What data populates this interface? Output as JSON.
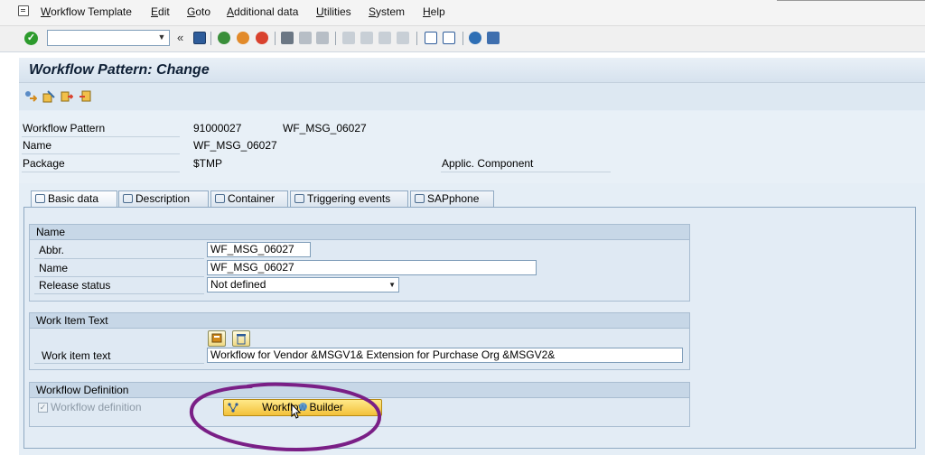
{
  "menu": {
    "items": [
      "Workflow Template",
      "Edit",
      "Goto",
      "Additional data",
      "Utilities",
      "System",
      "Help"
    ]
  },
  "toolbar": {
    "command_field_value": "",
    "icons": [
      "enter-icon",
      "command-dropdown-icon",
      "collapse-icon",
      "save-icon",
      "back-icon",
      "exit-icon",
      "cancel-icon",
      "print-icon",
      "find-icon",
      "find-next-icon",
      "first-page-icon",
      "previous-page-icon",
      "next-page-icon",
      "last-page-icon",
      "create-session-icon",
      "shortcut-icon",
      "help-icon",
      "layout-menu-icon"
    ]
  },
  "page": {
    "title": "Workflow Pattern: Change"
  },
  "header": {
    "workflow_pattern_label": "Workflow Pattern",
    "workflow_pattern_number": "91000027",
    "workflow_pattern_name": "WF_MSG_06027",
    "name_label": "Name",
    "name_value": "WF_MSG_06027",
    "package_label": "Package",
    "package_value": "$TMP",
    "applic_component_label": "Applic. Component"
  },
  "tabs": [
    {
      "label": "Basic data",
      "active": true
    },
    {
      "label": "Description",
      "active": false
    },
    {
      "label": "Container",
      "active": false
    },
    {
      "label": "Triggering events",
      "active": false
    },
    {
      "label": "SAPphone",
      "active": false
    }
  ],
  "name_group": {
    "title": "Name",
    "abbr_label": "Abbr.",
    "abbr_value": "WF_MSG_06027",
    "name_label": "Name",
    "name_value": "WF_MSG_06027",
    "release_status_label": "Release status",
    "release_status_value": "Not defined"
  },
  "work_item_group": {
    "title": "Work Item Text",
    "work_item_text_label": "Work item text",
    "work_item_text_value": "Workflow for Vendor &MSGV1& Extension for Purchase Org &MSGV2&"
  },
  "definition_group": {
    "title": "Workflow Definition",
    "checkbox_label": "Workflow definition",
    "checkbox_checked": true,
    "builder_button_label": "Workflow Builder"
  },
  "colors": {
    "highlight_ellipse": "#7a1f86",
    "builder_button": "#f3c13a"
  }
}
